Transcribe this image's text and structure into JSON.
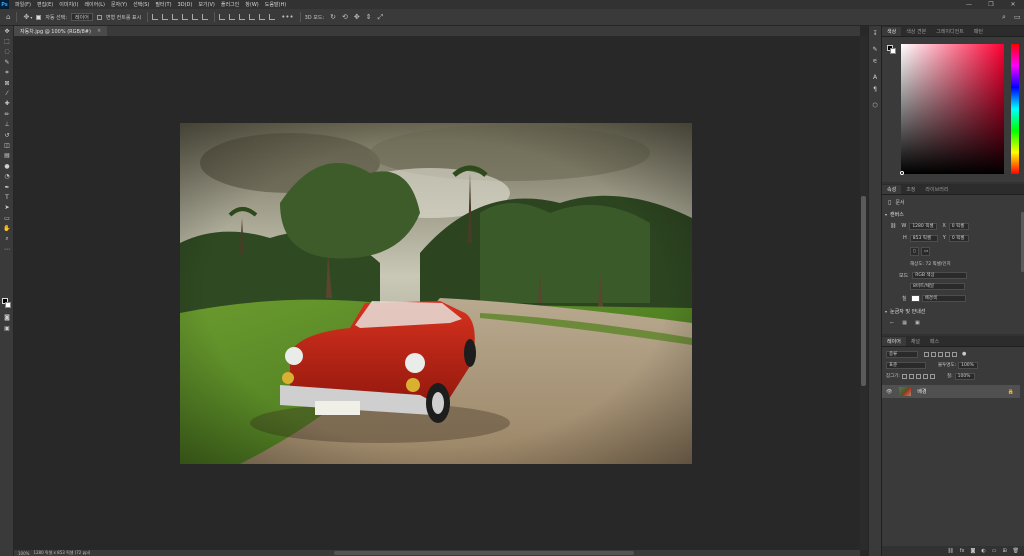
{
  "app": {
    "logo": "Ps"
  },
  "menu": [
    "파일(F)",
    "편집(E)",
    "이미지(I)",
    "레이어(L)",
    "문자(Y)",
    "선택(S)",
    "필터(T)",
    "3D(D)",
    "보기(V)",
    "플러그인",
    "창(W)",
    "도움말(H)"
  ],
  "window_controls": {
    "minimize": "—",
    "restore": "❐",
    "close": "✕"
  },
  "options_bar": {
    "auto_select_label": "자동 선택:",
    "auto_select_value": "레이어",
    "transform_label": "변형 컨트롤 표시",
    "mode_3d_label": "3D 모드:",
    "more": "•••"
  },
  "document": {
    "tab_title": "자동차.jpg @ 100% (RGB/8#)",
    "close": "×"
  },
  "status": {
    "zoom": "100%",
    "info": "1280 픽셀 x 853 픽셀 (72 ppi)"
  },
  "panels": {
    "color_tabs": [
      "색상",
      "색상 견본",
      "그레이디언트",
      "패턴"
    ],
    "props_tabs": [
      "속성",
      "조정",
      "라이브러리"
    ],
    "props": {
      "doc_label": "문서",
      "canvas_header": "캔버스",
      "w_label": "W",
      "w_value": "1280 픽셀",
      "h_label": "H",
      "h_value": "853 픽셀",
      "x_label": "X",
      "x_value": "0 픽셀",
      "y_label": "Y",
      "y_value": "0 픽셀",
      "resolution": "해상도: 72 픽셀/인치",
      "mode_label": "모드",
      "mode_value": "RGB 색상",
      "depth_value": "8비트/채널",
      "fill_label": "칠",
      "fill_value": "배경색",
      "rulers_header": "눈금자 및 안내선"
    },
    "layers_tabs": [
      "레이어",
      "채널",
      "패스"
    ],
    "layers": {
      "filter_placeholder": "종류",
      "blend_mode": "표준",
      "opacity_label": "불투명도:",
      "opacity_value": "100%",
      "lock_label": "잠그기:",
      "fill_label": "칠:",
      "fill_value": "100%",
      "items": [
        {
          "name": "배경",
          "visible": true,
          "locked": true
        }
      ],
      "bottom_icons": [
        "link-icon",
        "fx-icon",
        "mask-icon",
        "adjustment-icon",
        "group-icon",
        "new-layer-icon",
        "delete-icon"
      ]
    }
  },
  "colors": {
    "foreground": "#000000",
    "background": "#ffffff",
    "accent": "#31a8ff"
  }
}
